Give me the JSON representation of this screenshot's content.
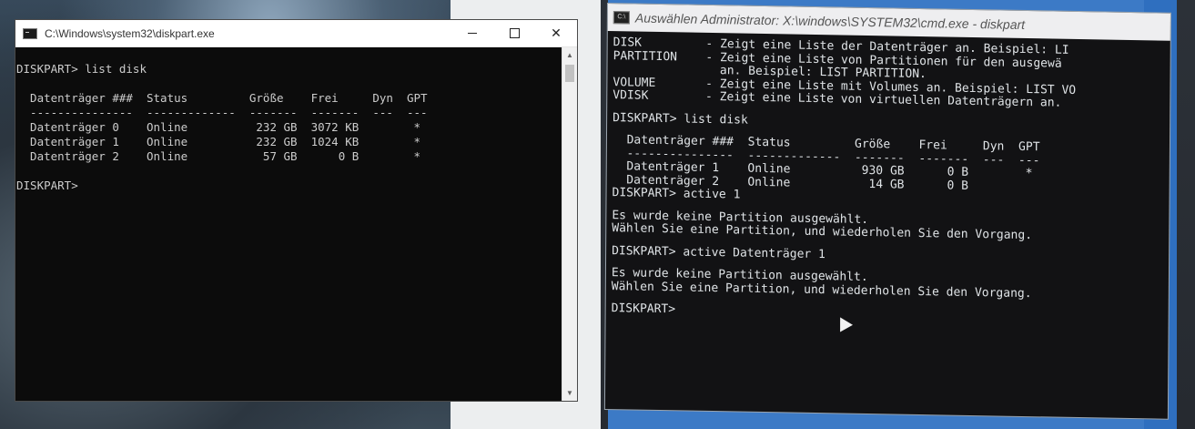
{
  "left_window": {
    "title": "C:\\Windows\\system32\\diskpart.exe",
    "controls": {
      "minimize": "—",
      "maximize": "☐",
      "close": "✕"
    },
    "console_lines": [
      "DISKPART> list disk",
      "",
      "  Datenträger ###  Status         Größe    Frei     Dyn  GPT",
      "  ---------------  -------------  -------  -------  ---  ---",
      "  Datenträger 0    Online          232 GB  3072 KB        *",
      "  Datenträger 1    Online          232 GB  1024 KB        *",
      "  Datenträger 2    Online           57 GB      0 B        *",
      "",
      "DISKPART> "
    ]
  },
  "photo_window": {
    "title": "Auswählen Administrator: X:\\windows\\SYSTEM32\\cmd.exe - diskpart",
    "icon_label": "C:\\",
    "lines": [
      "DISK         - Zeigt eine Liste der Datenträger an. Beispiel: LI",
      "PARTITION    - Zeigt eine Liste von Partitionen für den ausgewä",
      "               an. Beispiel: LIST PARTITION.",
      "VOLUME       - Zeigt eine Liste mit Volumes an. Beispiel: LIST VO",
      "VDISK        - Zeigt eine Liste von virtuellen Datenträgern an.",
      "",
      "DISKPART> list disk",
      "",
      "  Datenträger ###  Status         Größe    Frei     Dyn  GPT",
      "  ---------------  -------------  -------  -------  ---  ---",
      "  Datenträger 1    Online          930 GB      0 B        *",
      "  Datenträger 2    Online           14 GB      0 B",
      "DISKPART> active 1",
      "",
      "Es wurde keine Partition ausgewählt.",
      "Wählen Sie eine Partition, und wiederholen Sie den Vorgang.",
      "",
      "DISKPART> active Datenträger 1",
      "",
      "Es wurde keine Partition ausgewählt.",
      "Wählen Sie eine Partition, und wiederholen Sie den Vorgang.",
      "",
      "DISKPART>"
    ]
  },
  "colors": {
    "console_bg": "#0c0c0c",
    "console_text": "#cccccc",
    "titlebar_bg": "#ffffff",
    "photo_screen_blue": "#3c7ac6"
  },
  "icons": {
    "scroll_up": "▲",
    "scroll_down": "▼"
  }
}
